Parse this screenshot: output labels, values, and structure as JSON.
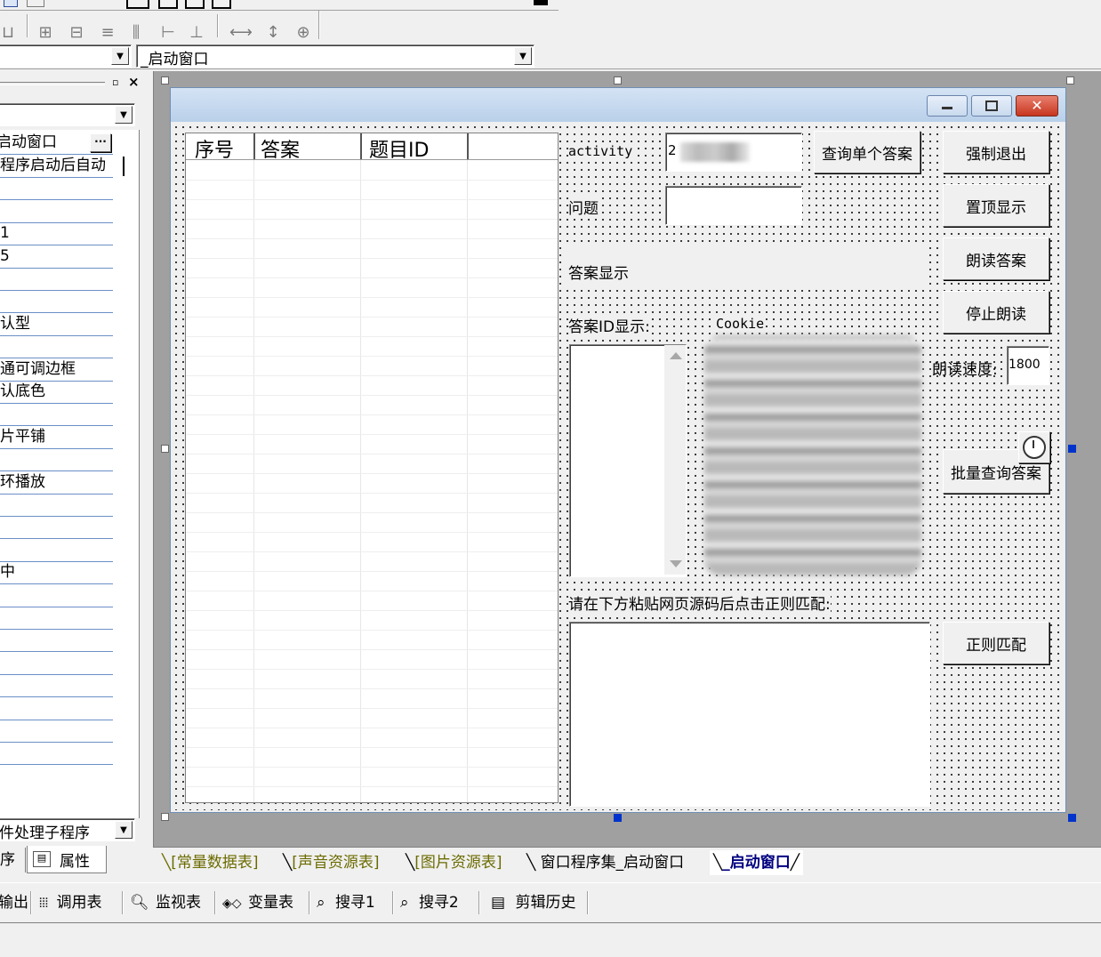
{
  "toolbar": {
    "icons_row1": [
      "save-icon",
      "open-icon",
      "print-icon",
      "window-icon",
      "align-icon",
      "grid-icon",
      "run-icon",
      "arrow-icon"
    ],
    "icons_row2": [
      "align-left-icon",
      "center-horizontal-icon",
      "center-vertical-icon",
      "align-top-icon",
      "space-horizontal-icon",
      "space-vertical-icon",
      "same-width-icon",
      "same-height-icon",
      "same-size-icon"
    ]
  },
  "object_selector": {
    "value": "",
    "window_value": "_启动窗口"
  },
  "property_panel": {
    "header_value": "",
    "name_value": "启动窗口",
    "ellipsis": "···",
    "rows": [
      "程序启动后自动",
      "",
      "",
      "1",
      "5",
      "",
      "",
      "认型",
      "",
      "通可调边框",
      "认底色",
      "",
      "片平铺",
      "",
      "环播放",
      "",
      "",
      "",
      "中",
      "",
      "",
      "",
      "",
      "",
      "",
      "",
      ""
    ],
    "event_combo": "件处理子程序",
    "tab_program": "序",
    "tab_property": "属性"
  },
  "form": {
    "table_headers": [
      "序号",
      "答案",
      "题目ID"
    ],
    "activity_label": "activity",
    "activity_value": "2",
    "query_single_button": "查询单个答案",
    "question_label": "问题",
    "question_value": "",
    "answer_display_label": "答案显示",
    "answer_id_label": "答案ID显示:",
    "cookie_label": "Cookie",
    "read_speed_label": "朗读速度:",
    "read_speed_value": "1800",
    "paste_instruction": "请在下方粘贴网页源码后点击正则匹配:",
    "buttons": {
      "force_exit": "强制退出",
      "topmost": "置顶显示",
      "read_answer": "朗读答案",
      "stop_reading": "停止朗读",
      "batch_query": "批量查询答案",
      "regex_match": "正则匹配"
    },
    "timer_icon": "timer-icon"
  },
  "editor_tabs": [
    "[常量数据表]",
    "[声音资源表]",
    "[图片资源表]",
    "窗口程序集_启动窗口",
    "_启动窗口"
  ],
  "bottom_bar": {
    "items": [
      "输出",
      "调用表",
      "监视表",
      "变量表",
      "搜寻1",
      "搜寻2",
      "剪辑历史"
    ]
  },
  "colors": {
    "title_bar": "#c4d8ef",
    "close_button": "#d9432f",
    "tab_resource_text": "#6b6b00",
    "selected_handle": "#0033cc"
  }
}
